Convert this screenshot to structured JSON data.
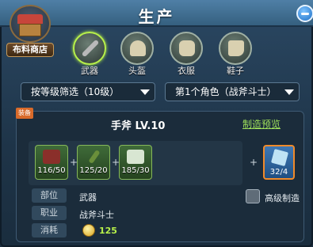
{
  "header": {
    "title": "生产"
  },
  "shop": {
    "label": "布料商店"
  },
  "categories": [
    {
      "label": "武器",
      "active": true
    },
    {
      "label": "头盔",
      "active": false
    },
    {
      "label": "衣服",
      "active": false
    },
    {
      "label": "鞋子",
      "active": false
    }
  ],
  "filters": {
    "level": "按等级筛选（10级）",
    "role": "第1个角色（战斧斗士）"
  },
  "detail": {
    "tag": "装备",
    "item_name": "手斧 LV.10",
    "preview_label": "制造预览",
    "materials": [
      {
        "count": "116/50",
        "icon": "ore-icon"
      },
      {
        "count": "125/20",
        "icon": "wand-icon"
      },
      {
        "count": "185/30",
        "icon": "cloth-icon"
      }
    ],
    "result": {
      "count": "32/4",
      "icon": "crystal-icon"
    },
    "advanced_label": "高级制造",
    "info": [
      {
        "label": "部位",
        "value": "武器"
      },
      {
        "label": "职业",
        "value": "战斧斗士"
      },
      {
        "label": "消耗",
        "value": "125"
      }
    ]
  },
  "colors": {
    "accent": "#9ee05a",
    "active_ring": "#b7f04a",
    "result_border": "#f08a2a"
  }
}
